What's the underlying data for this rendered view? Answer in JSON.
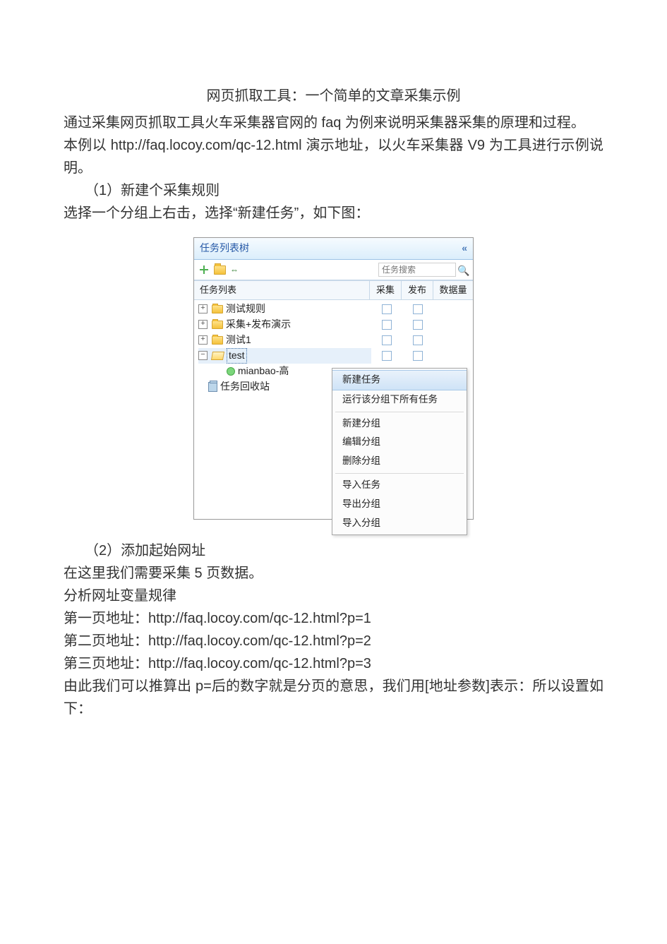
{
  "doc": {
    "title": "网页抓取工具：一个简单的文章采集示例",
    "p1": "通过采集网页抓取工具火车采集器官网的 faq 为例来说明采集器采集的原理和过程。",
    "p2": "本例以 http://faq.locoy.com/qc-12.html  演示地址，以火车采集器 V9 为工具进行示例说明。",
    "s1_num": "（1）新建个采集规则",
    "s1_text": "选择一个分组上右击，选择“新建任务”，如下图：",
    "s2_num": "（2）添加起始网址",
    "s2_l1": "在这里我们需要采集 5 页数据。",
    "s2_l2": "分析网址变量规律",
    "s2_l3": "第一页地址：http://faq.locoy.com/qc-12.html?p=1",
    "s2_l4": "第二页地址：http://faq.locoy.com/qc-12.html?p=2",
    "s2_l5": "第三页地址：http://faq.locoy.com/qc-12.html?p=3",
    "s2_l6": "由此我们可以推算出 p=后的数字就是分页的意思，我们用[地址参数]表示：所以设置如下："
  },
  "panel": {
    "header": "任务列表树",
    "collapse_glyph": "«",
    "expand_glyph": "⇔",
    "search_placeholder": "任务搜索",
    "grid": {
      "col_name": "任务列表",
      "col_caiji": "采集",
      "col_fabu": "发布",
      "col_data": "数据量"
    },
    "tree": {
      "n1": "测试规则",
      "n2": "采集+发布演示",
      "n3": "测试1",
      "n4": "test",
      "n4a": "mianbao-高",
      "recycle": "任务回收站"
    }
  },
  "ctx": {
    "m1": "新建任务",
    "m2": "运行该分组下所有任务",
    "m3": "新建分组",
    "m4": "编辑分组",
    "m5": "删除分组",
    "m6": "导入任务",
    "m7": "导出分组",
    "m8": "导入分组"
  }
}
